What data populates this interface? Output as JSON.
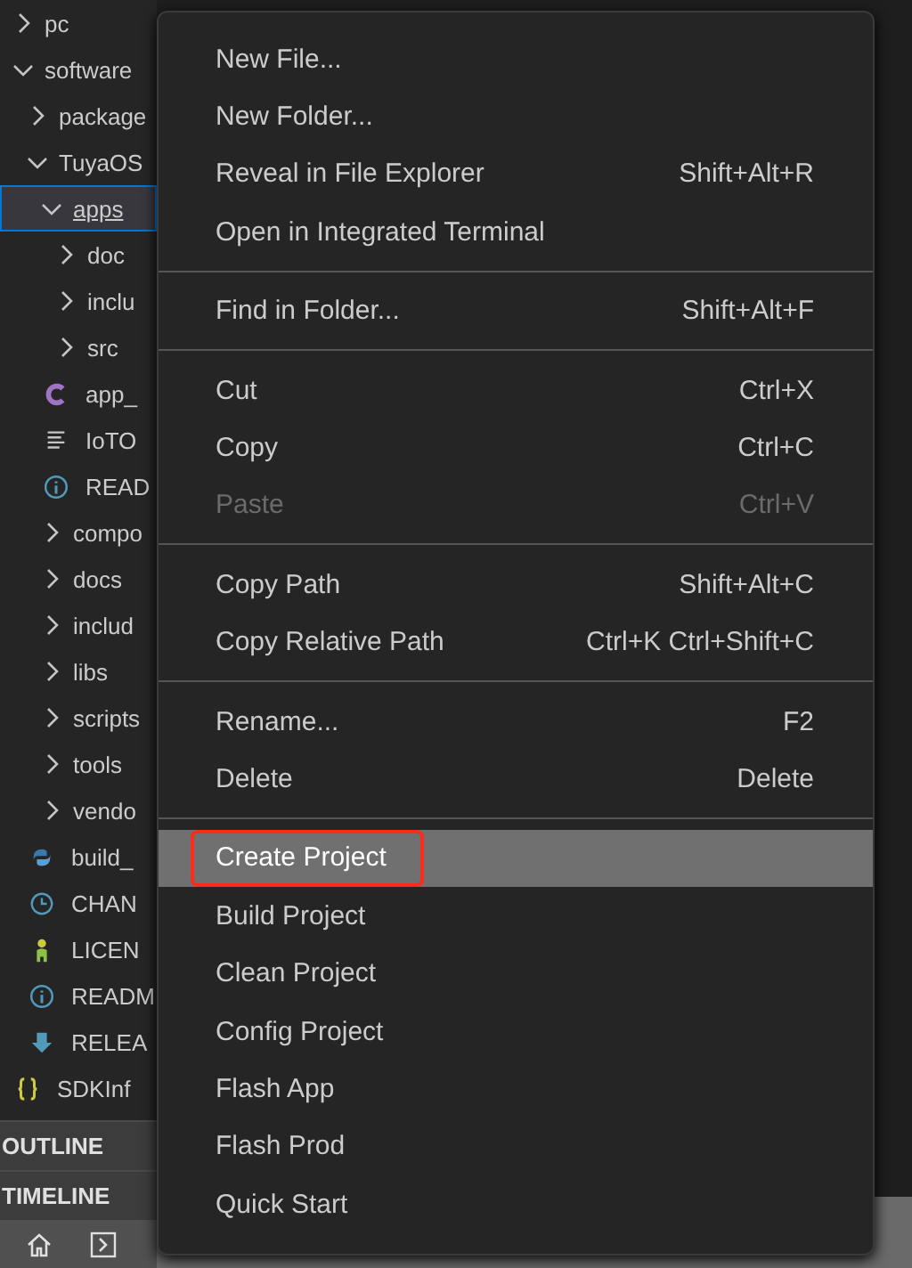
{
  "tree": [
    {
      "label": "pc",
      "kind": "folder",
      "expanded": false,
      "selected": false
    },
    {
      "label": "software",
      "kind": "folder",
      "expanded": true,
      "selected": false,
      "children": [
        {
          "label": "package",
          "kind": "folder",
          "expanded": false,
          "selected": false
        },
        {
          "label": "TuyaOS",
          "kind": "folder",
          "expanded": true,
          "selected": false,
          "children": [
            {
              "label": "apps",
              "kind": "folder",
              "expanded": true,
              "selected": true,
              "children": [
                {
                  "label": "doc",
                  "kind": "folder",
                  "expanded": false,
                  "selected": false
                },
                {
                  "label": "inclu",
                  "kind": "folder",
                  "expanded": false,
                  "selected": false
                },
                {
                  "label": "src",
                  "kind": "folder",
                  "expanded": false,
                  "selected": false
                },
                {
                  "label": "app_",
                  "kind": "c",
                  "selected": false
                },
                {
                  "label": "IoTO",
                  "kind": "text",
                  "selected": false
                },
                {
                  "label": "READ",
                  "kind": "info",
                  "selected": false
                }
              ]
            },
            {
              "label": "compo",
              "kind": "folder",
              "expanded": false,
              "selected": false
            },
            {
              "label": "docs",
              "kind": "folder",
              "expanded": false,
              "selected": false
            },
            {
              "label": "includ",
              "kind": "folder",
              "expanded": false,
              "selected": false
            },
            {
              "label": "libs",
              "kind": "folder",
              "expanded": false,
              "selected": false
            },
            {
              "label": "scripts",
              "kind": "folder",
              "expanded": false,
              "selected": false
            },
            {
              "label": "tools",
              "kind": "folder",
              "expanded": false,
              "selected": false
            },
            {
              "label": "vendo",
              "kind": "folder",
              "expanded": false,
              "selected": false
            },
            {
              "label": "build_",
              "kind": "python",
              "selected": false
            },
            {
              "label": "CHAN",
              "kind": "history",
              "selected": false
            },
            {
              "label": "LICEN",
              "kind": "license",
              "selected": false
            },
            {
              "label": "READM",
              "kind": "info",
              "selected": false
            },
            {
              "label": "RELEA",
              "kind": "download",
              "selected": false
            }
          ]
        },
        {
          "label": "SDKInf",
          "kind": "json",
          "selected": false
        }
      ]
    }
  ],
  "panels": [
    {
      "label": "OUTLINE"
    },
    {
      "label": "TIMELINE"
    }
  ],
  "menu": [
    [
      {
        "label": "New File...",
        "disabled": false,
        "selected": false,
        "boxed": false
      },
      {
        "label": "New Folder...",
        "disabled": false,
        "selected": false,
        "boxed": false
      },
      {
        "label": "Reveal in File Explorer",
        "shortcut": "Shift+Alt+R",
        "disabled": false,
        "selected": false,
        "boxed": false
      },
      {
        "label": "Open in Integrated Terminal",
        "disabled": false,
        "selected": false,
        "boxed": false
      }
    ],
    [
      {
        "label": "Find in Folder...",
        "shortcut": "Shift+Alt+F",
        "disabled": false,
        "selected": false,
        "boxed": false
      }
    ],
    [
      {
        "label": "Cut",
        "shortcut": "Ctrl+X",
        "disabled": false,
        "selected": false,
        "boxed": false
      },
      {
        "label": "Copy",
        "shortcut": "Ctrl+C",
        "disabled": false,
        "selected": false,
        "boxed": false
      },
      {
        "label": "Paste",
        "shortcut": "Ctrl+V",
        "disabled": true,
        "selected": false,
        "boxed": false
      }
    ],
    [
      {
        "label": "Copy Path",
        "shortcut": "Shift+Alt+C",
        "disabled": false,
        "selected": false,
        "boxed": false
      },
      {
        "label": "Copy Relative Path",
        "shortcut": "Ctrl+K Ctrl+Shift+C",
        "disabled": false,
        "selected": false,
        "boxed": false
      }
    ],
    [
      {
        "label": "Rename...",
        "shortcut": "F2",
        "disabled": false,
        "selected": false,
        "boxed": false
      },
      {
        "label": "Delete",
        "shortcut": "Delete",
        "disabled": false,
        "selected": false,
        "boxed": false
      }
    ],
    [
      {
        "label": "Create Project",
        "disabled": false,
        "selected": true,
        "boxed": true
      },
      {
        "label": "Build Project",
        "disabled": false,
        "selected": false,
        "boxed": false
      },
      {
        "label": "Clean Project",
        "disabled": false,
        "selected": false,
        "boxed": false
      },
      {
        "label": "Config Project",
        "disabled": false,
        "selected": false,
        "boxed": false
      },
      {
        "label": "Flash App",
        "disabled": false,
        "selected": false,
        "boxed": false
      },
      {
        "label": "Flash Prod",
        "disabled": false,
        "selected": false,
        "boxed": false
      },
      {
        "label": "Quick Start",
        "disabled": false,
        "selected": false,
        "boxed": false
      }
    ]
  ]
}
